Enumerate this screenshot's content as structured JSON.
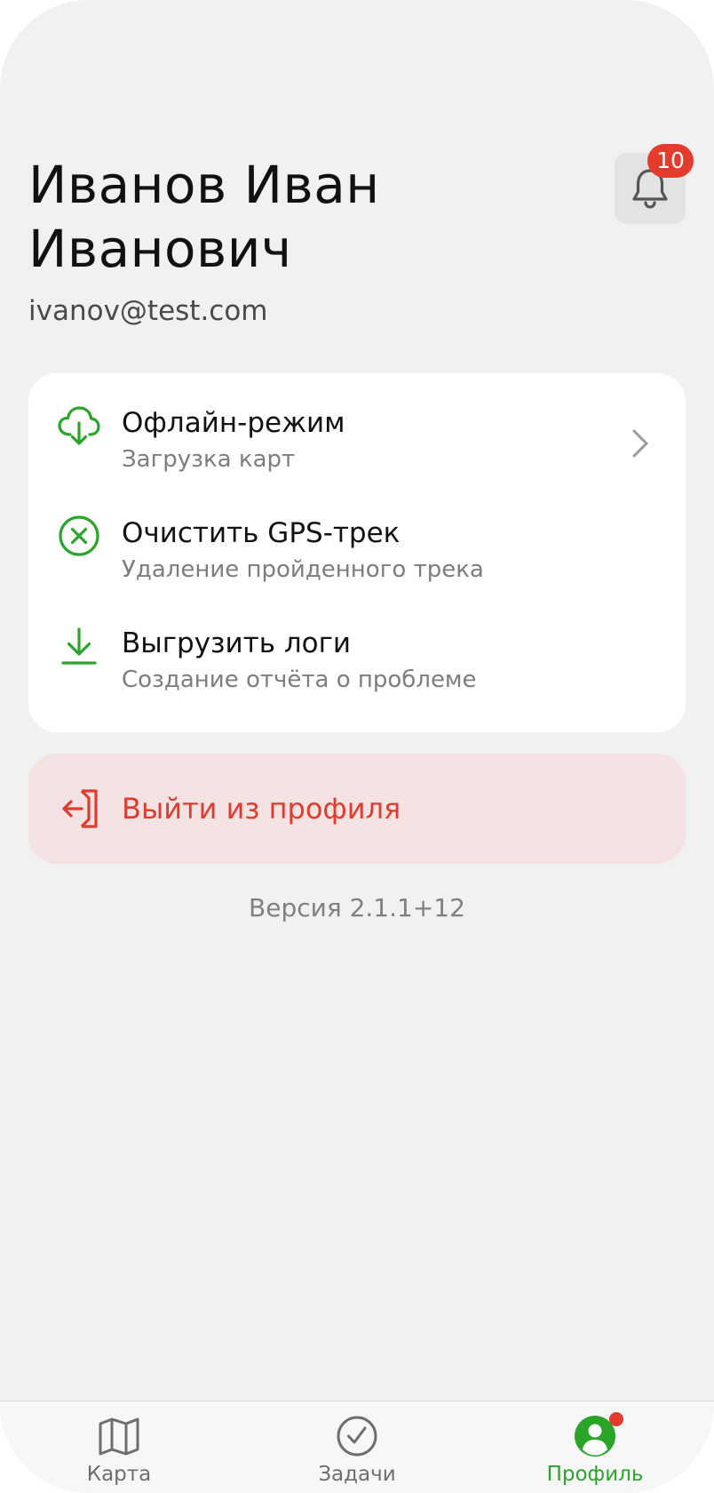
{
  "header": {
    "name_line1": "Иванов Иван",
    "name_line2": "Иванович",
    "email": "ivanov@test.com",
    "notification_icon": "bell-icon",
    "notification_count": "10"
  },
  "menu": {
    "items": [
      {
        "title": "Офлайн-режим",
        "subtitle": "Загрузка карт",
        "icon": "cloud-download-icon"
      },
      {
        "title": "Очистить GPS-трек",
        "subtitle": "Удаление пройденного трека",
        "icon": "clear-circle-icon"
      },
      {
        "title": "Выгрузить логи",
        "subtitle": "Создание отчёта о проблеме",
        "icon": "download-icon"
      }
    ]
  },
  "logout": {
    "label": "Выйти из профиля",
    "icon": "logout-icon"
  },
  "version": "Версия 2.1.1+12",
  "tabbar": {
    "tabs": [
      {
        "label": "Карта",
        "icon": "map-icon"
      },
      {
        "label": "Задачи",
        "icon": "check-circle-icon"
      },
      {
        "label": "Профиль",
        "icon": "profile-icon",
        "active": true
      }
    ]
  },
  "colors": {
    "accent_green": "#2aa52a",
    "danger_red": "#e23b2e",
    "logout_bg": "#f4e3e2",
    "badge_red": "#e53b2c",
    "background": "#f1f1f1"
  }
}
